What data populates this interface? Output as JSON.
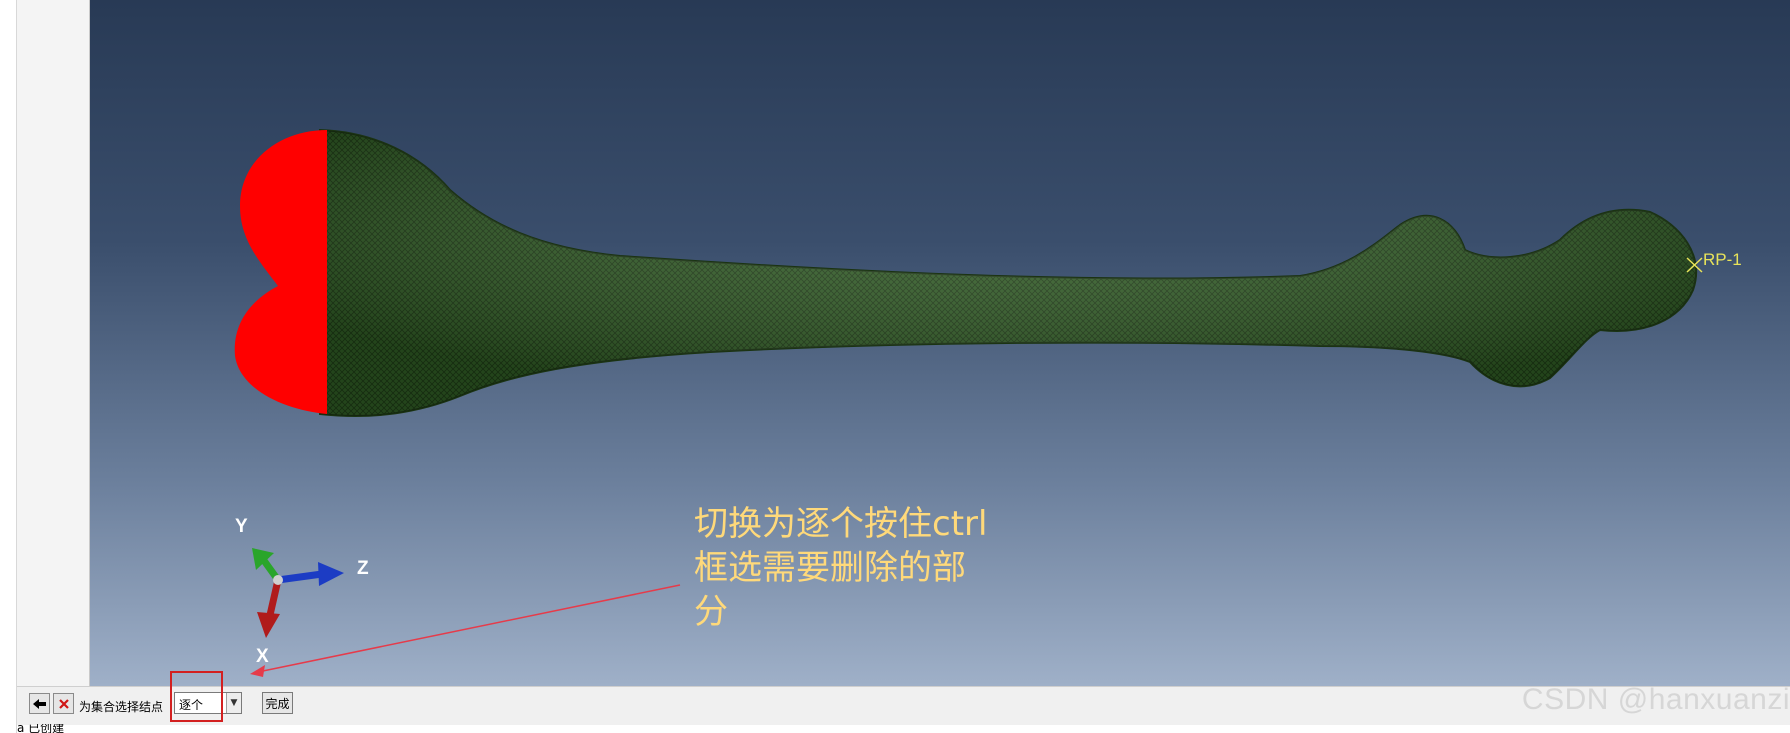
{
  "viewport": {
    "annotation_lines": [
      "切换为逐个按住ctrl",
      "框选需要删除的部",
      "分"
    ],
    "reference_point": "RP-1",
    "triad": {
      "y_label": "Y",
      "z_label": "Z",
      "x_label": "X"
    },
    "colors": {
      "mesh": "#2f5a24",
      "selected_nodes": "#ff0000",
      "annotation": "#ffd97a",
      "arrow": "#e63b4a"
    }
  },
  "prompt_bar": {
    "back_icon": "arrow-left-icon",
    "cancel_icon": "close-icon",
    "prompt_text": "为集合选择结点",
    "selection_mode": "逐个",
    "done_label": "完成"
  },
  "status_line": "a 已创建",
  "watermark": "CSDN @hanxuanzi"
}
